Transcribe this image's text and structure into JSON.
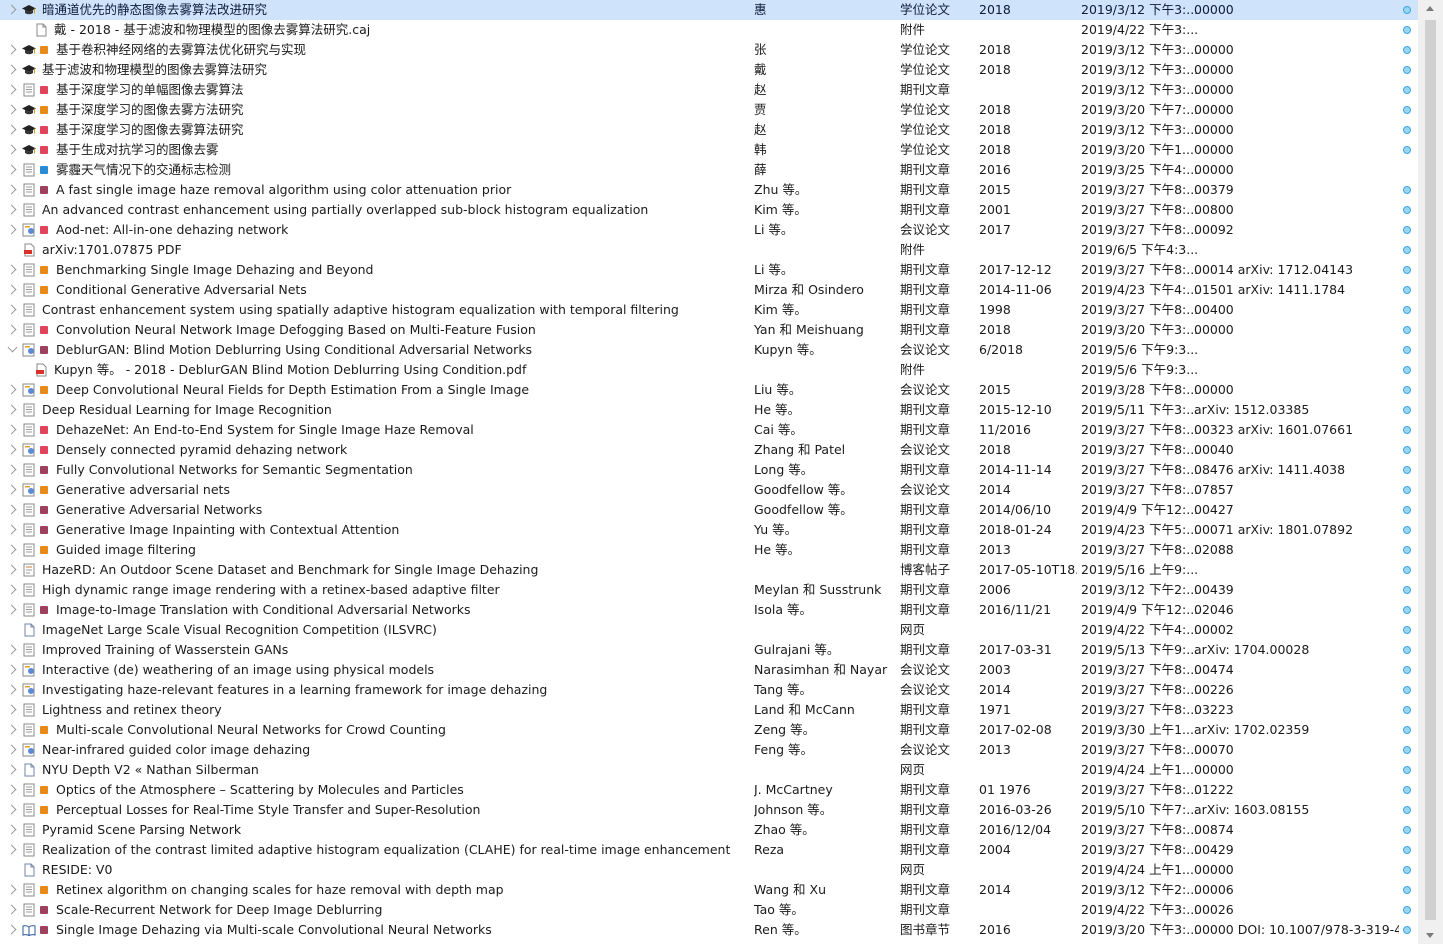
{
  "rows": [
    {
      "expander": "closed",
      "icon": "thesis",
      "dot": "",
      "title": "暗通道优先的静态图像去雾算法改进研究",
      "creator": "惠",
      "type": "学位论文",
      "date": "2018",
      "modified": "2019/3/12 下午3:...",
      "extra": "00000",
      "attachment": true,
      "selected": true
    },
    {
      "expander": "none",
      "icon": "file",
      "dot": "",
      "title": "戴 - 2018 - 基于滤波和物理模型的图像去雾算法研究.caj",
      "creator": "",
      "type": "附件",
      "date": "",
      "modified": "2019/4/22 下午3:...",
      "extra": "",
      "attachment": true,
      "child": true
    },
    {
      "expander": "closed",
      "icon": "thesis",
      "dot": "#e88a1a",
      "title": "基于卷积神经网络的去雾算法优化研究与实现",
      "creator": "张",
      "type": "学位论文",
      "date": "2018",
      "modified": "2019/3/12 下午3:...",
      "extra": "00000",
      "attachment": true
    },
    {
      "expander": "closed",
      "icon": "thesis",
      "dot": "",
      "title": "基于滤波和物理模型的图像去雾算法研究",
      "creator": "戴",
      "type": "学位论文",
      "date": "2018",
      "modified": "2019/3/12 下午3:...",
      "extra": "00000",
      "attachment": true
    },
    {
      "expander": "closed",
      "icon": "article",
      "dot": "#e2425b",
      "title": "基于深度学习的单幅图像去雾算法",
      "creator": "赵",
      "type": "期刊文章",
      "date": "",
      "modified": "2019/3/12 下午3:...",
      "extra": "00000",
      "attachment": true
    },
    {
      "expander": "closed",
      "icon": "thesis",
      "dot": "#e88a1a",
      "title": "基于深度学习的图像去雾方法研究",
      "creator": "贾",
      "type": "学位论文",
      "date": "2018",
      "modified": "2019/3/20 下午7:...",
      "extra": "00000",
      "attachment": true
    },
    {
      "expander": "closed",
      "icon": "thesis",
      "dot": "#e2425b",
      "title": "基于深度学习的图像去雾算法研究",
      "creator": "赵",
      "type": "学位论文",
      "date": "2018",
      "modified": "2019/3/12 下午3:...",
      "extra": "00000",
      "attachment": true
    },
    {
      "expander": "closed",
      "icon": "thesis",
      "dot": "#e2425b",
      "title": "基于生成对抗学习的图像去雾",
      "creator": "韩",
      "type": "学位论文",
      "date": "2018",
      "modified": "2019/3/20 下午1...",
      "extra": "00000",
      "attachment": true
    },
    {
      "expander": "closed",
      "icon": "article",
      "dot": "#2a8ad4",
      "title": "雾霾天气情况下的交通标志检测",
      "creator": "薛",
      "type": "期刊文章",
      "date": "2016",
      "modified": "2019/3/25 下午4:...",
      "extra": "00000",
      "attachment": false
    },
    {
      "expander": "closed",
      "icon": "article",
      "dot": "#a0405f",
      "title": "A fast single image haze removal algorithm using color attenuation prior",
      "creator": "Zhu 等。",
      "type": "期刊文章",
      "date": "2015",
      "modified": "2019/3/27 下午8:...",
      "extra": "00379",
      "attachment": true
    },
    {
      "expander": "closed",
      "icon": "article",
      "dot": "",
      "title": "An advanced contrast enhancement using partially overlapped sub-block histogram equalization",
      "creator": "Kim 等。",
      "type": "期刊文章",
      "date": "2001",
      "modified": "2019/3/27 下午8:...",
      "extra": "00800",
      "attachment": true
    },
    {
      "expander": "closed",
      "icon": "conference",
      "dot": "#e2425b",
      "title": "Aod-net: All-in-one dehazing network",
      "creator": "Li 等。",
      "type": "会议论文",
      "date": "2017",
      "modified": "2019/3/27 下午8:...",
      "extra": "00092",
      "attachment": true
    },
    {
      "expander": "none",
      "icon": "pdf",
      "dot": "",
      "title": "arXiv:1701.07875 PDF",
      "creator": "",
      "type": "附件",
      "date": "",
      "modified": "2019/6/5 下午4:3...",
      "extra": "",
      "attachment": true
    },
    {
      "expander": "closed",
      "icon": "article",
      "dot": "#e88a1a",
      "title": "Benchmarking Single Image Dehazing and Beyond",
      "creator": "Li 等。",
      "type": "期刊文章",
      "date": "2017-12-12",
      "modified": "2019/3/27 下午8:...",
      "extra": "00014 arXiv: 1712.04143",
      "attachment": true
    },
    {
      "expander": "closed",
      "icon": "article",
      "dot": "#e88a1a",
      "title": "Conditional Generative Adversarial Nets",
      "creator": "Mirza 和 Osindero",
      "type": "期刊文章",
      "date": "2014-11-06",
      "modified": "2019/4/23 下午4:...",
      "extra": "01501 arXiv: 1411.1784",
      "attachment": true
    },
    {
      "expander": "closed",
      "icon": "article",
      "dot": "",
      "title": "Contrast enhancement system using spatially adaptive histogram equalization with temporal filtering",
      "creator": "Kim 等。",
      "type": "期刊文章",
      "date": "1998",
      "modified": "2019/3/27 下午8:...",
      "extra": "00400",
      "attachment": true
    },
    {
      "expander": "closed",
      "icon": "article",
      "dot": "#e2425b",
      "title": "Convolution Neural Network Image Defogging Based on Multi-Feature Fusion",
      "creator": "Yan 和 Meishuang",
      "type": "期刊文章",
      "date": "2018",
      "modified": "2019/3/20 下午3:...",
      "extra": "00000",
      "attachment": true
    },
    {
      "expander": "open",
      "icon": "conference",
      "dot": "#a0405f",
      "title": "DeblurGAN: Blind Motion Deblurring Using Conditional Adversarial Networks",
      "creator": "Kupyn 等。",
      "type": "会议论文",
      "date": "6/2018",
      "modified": "2019/5/6 下午9:3...",
      "extra": "",
      "attachment": true
    },
    {
      "expander": "none",
      "icon": "pdf",
      "dot": "",
      "title": "Kupyn 等。 - 2018 - DeblurGAN Blind Motion Deblurring Using Condition.pdf",
      "creator": "",
      "type": "附件",
      "date": "",
      "modified": "2019/5/6 下午9:3...",
      "extra": "",
      "attachment": true,
      "child": true
    },
    {
      "expander": "closed",
      "icon": "conference",
      "dot": "#e88a1a",
      "title": "Deep Convolutional Neural Fields for Depth Estimation From a Single Image",
      "creator": "Liu 等。",
      "type": "会议论文",
      "date": "2015",
      "modified": "2019/3/28 下午8:...",
      "extra": "00000",
      "attachment": true
    },
    {
      "expander": "closed",
      "icon": "article",
      "dot": "",
      "title": "Deep Residual Learning for Image Recognition",
      "creator": "He 等。",
      "type": "期刊文章",
      "date": "2015-12-10",
      "modified": "2019/5/11 下午3:...",
      "extra": "arXiv: 1512.03385",
      "attachment": true
    },
    {
      "expander": "closed",
      "icon": "article",
      "dot": "#e2425b",
      "title": "DehazeNet: An End-to-End System for Single Image Haze Removal",
      "creator": "Cai 等。",
      "type": "期刊文章",
      "date": "11/2016",
      "modified": "2019/3/27 下午8:...",
      "extra": "00323 arXiv: 1601.07661",
      "attachment": true
    },
    {
      "expander": "closed",
      "icon": "conference",
      "dot": "#e2425b",
      "title": "Densely connected pyramid dehazing network",
      "creator": "Zhang 和 Patel",
      "type": "会议论文",
      "date": "2018",
      "modified": "2019/3/27 下午8:...",
      "extra": "00040",
      "attachment": true
    },
    {
      "expander": "closed",
      "icon": "article",
      "dot": "#a0405f",
      "title": "Fully Convolutional Networks for Semantic Segmentation",
      "creator": "Long 等。",
      "type": "期刊文章",
      "date": "2014-11-14",
      "modified": "2019/3/27 下午8:...",
      "extra": "08476 arXiv: 1411.4038",
      "attachment": true
    },
    {
      "expander": "closed",
      "icon": "conference",
      "dot": "#e88a1a",
      "title": "Generative adversarial nets",
      "creator": "Goodfellow 等。",
      "type": "会议论文",
      "date": "2014",
      "modified": "2019/3/27 下午8:...",
      "extra": "07857",
      "attachment": true
    },
    {
      "expander": "closed",
      "icon": "article",
      "dot": "#a0405f",
      "title": "Generative Adversarial Networks",
      "creator": "Goodfellow 等。",
      "type": "期刊文章",
      "date": "2014/06/10",
      "modified": "2019/4/9 下午12:...",
      "extra": "00427",
      "attachment": true
    },
    {
      "expander": "closed",
      "icon": "article",
      "dot": "#a0405f",
      "title": "Generative Image Inpainting with Contextual Attention",
      "creator": "Yu 等。",
      "type": "期刊文章",
      "date": "2018-01-24",
      "modified": "2019/4/23 下午5:...",
      "extra": "00071 arXiv: 1801.07892",
      "attachment": true
    },
    {
      "expander": "closed",
      "icon": "article",
      "dot": "#e88a1a",
      "title": "Guided image filtering",
      "creator": "He 等。",
      "type": "期刊文章",
      "date": "2013",
      "modified": "2019/3/27 下午8:...",
      "extra": "02088",
      "attachment": true
    },
    {
      "expander": "closed",
      "icon": "blog",
      "dot": "",
      "title": "HazeRD: An Outdoor Scene Dataset and Benchmark for Single Image Dehazing",
      "creator": "",
      "type": "博客帖子",
      "date": "2017-05-10T18...",
      "modified": "2019/5/16 上午9:...",
      "extra": "",
      "attachment": true
    },
    {
      "expander": "closed",
      "icon": "article",
      "dot": "",
      "title": "High dynamic range image rendering with a retinex-based adaptive filter",
      "creator": "Meylan 和 Susstrunk",
      "type": "期刊文章",
      "date": "2006",
      "modified": "2019/3/12 下午2:...",
      "extra": "00439",
      "attachment": true
    },
    {
      "expander": "closed",
      "icon": "article",
      "dot": "#a0405f",
      "title": "Image-to-Image Translation with Conditional Adversarial Networks",
      "creator": "Isola 等。",
      "type": "期刊文章",
      "date": "2016/11/21",
      "modified": "2019/4/9 下午12:...",
      "extra": "02046",
      "attachment": true
    },
    {
      "expander": "none",
      "icon": "webpage",
      "dot": "",
      "title": "ImageNet Large Scale Visual Recognition Competition (ILSVRC)",
      "creator": "",
      "type": "网页",
      "date": "",
      "modified": "2019/4/22 下午4:...",
      "extra": "00002",
      "attachment": true
    },
    {
      "expander": "closed",
      "icon": "article",
      "dot": "",
      "title": "Improved Training of Wasserstein GANs",
      "creator": "Gulrajani 等。",
      "type": "期刊文章",
      "date": "2017-03-31",
      "modified": "2019/5/13 下午9:...",
      "extra": "arXiv: 1704.00028",
      "attachment": true
    },
    {
      "expander": "closed",
      "icon": "conference",
      "dot": "",
      "title": "Interactive (de) weathering of an image using physical models",
      "creator": "Narasimhan 和 Nayar",
      "type": "会议论文",
      "date": "2003",
      "modified": "2019/3/27 下午8:...",
      "extra": "00474",
      "attachment": true
    },
    {
      "expander": "closed",
      "icon": "conference",
      "dot": "",
      "title": "Investigating haze-relevant features in a learning framework for image dehazing",
      "creator": "Tang 等。",
      "type": "会议论文",
      "date": "2014",
      "modified": "2019/3/27 下午8:...",
      "extra": "00226",
      "attachment": true
    },
    {
      "expander": "closed",
      "icon": "article",
      "dot": "",
      "title": "Lightness and retinex theory",
      "creator": "Land 和 McCann",
      "type": "期刊文章",
      "date": "1971",
      "modified": "2019/3/27 下午8:...",
      "extra": "03223",
      "attachment": true
    },
    {
      "expander": "closed",
      "icon": "article",
      "dot": "#e88a1a",
      "title": "Multi-scale Convolutional Neural Networks for Crowd Counting",
      "creator": "Zeng 等。",
      "type": "期刊文章",
      "date": "2017-02-08",
      "modified": "2019/3/30 上午1...",
      "extra": "arXiv: 1702.02359",
      "attachment": true
    },
    {
      "expander": "closed",
      "icon": "conference",
      "dot": "",
      "title": "Near-infrared guided color image dehazing",
      "creator": "Feng 等。",
      "type": "会议论文",
      "date": "2013",
      "modified": "2019/3/27 下午8:...",
      "extra": "00070",
      "attachment": true
    },
    {
      "expander": "closed",
      "icon": "webpage",
      "dot": "",
      "title": "NYU Depth V2 « Nathan Silberman",
      "creator": "",
      "type": "网页",
      "date": "",
      "modified": "2019/4/24 上午1...",
      "extra": "00000",
      "attachment": true
    },
    {
      "expander": "closed",
      "icon": "article",
      "dot": "#e88a1a",
      "title": "Optics of the Atmosphere – Scattering by Molecules and Particles",
      "creator": "J. McCartney",
      "type": "期刊文章",
      "date": "01 1976",
      "modified": "2019/3/27 下午8:...",
      "extra": "01222",
      "attachment": true
    },
    {
      "expander": "closed",
      "icon": "article",
      "dot": "#e88a1a",
      "title": "Perceptual Losses for Real-Time Style Transfer and Super-Resolution",
      "creator": "Johnson 等。",
      "type": "期刊文章",
      "date": "2016-03-26",
      "modified": "2019/5/10 下午7:...",
      "extra": "arXiv: 1603.08155",
      "attachment": true
    },
    {
      "expander": "closed",
      "icon": "article",
      "dot": "",
      "title": "Pyramid Scene Parsing Network",
      "creator": "Zhao 等。",
      "type": "期刊文章",
      "date": "2016/12/04",
      "modified": "2019/3/27 下午8:...",
      "extra": "00874",
      "attachment": true
    },
    {
      "expander": "closed",
      "icon": "article",
      "dot": "",
      "title": "Realization of the contrast limited adaptive histogram equalization (CLAHE) for real-time image enhancement",
      "creator": "Reza",
      "type": "期刊文章",
      "date": "2004",
      "modified": "2019/3/27 下午8:...",
      "extra": "00429",
      "attachment": true
    },
    {
      "expander": "none",
      "icon": "webpage",
      "dot": "",
      "title": "RESIDE: V0",
      "creator": "",
      "type": "网页",
      "date": "",
      "modified": "2019/4/24 上午1...",
      "extra": "00000",
      "attachment": true
    },
    {
      "expander": "closed",
      "icon": "article",
      "dot": "#e88a1a",
      "title": "Retinex algorithm on changing scales for haze removal with depth map",
      "creator": "Wang 和 Xu",
      "type": "期刊文章",
      "date": "2014",
      "modified": "2019/3/12 下午2:...",
      "extra": "00006",
      "attachment": true
    },
    {
      "expander": "closed",
      "icon": "article",
      "dot": "#a0405f",
      "title": "Scale-Recurrent Network for Deep Image Deblurring",
      "creator": "Tao 等。",
      "type": "期刊文章",
      "date": "",
      "modified": "2019/4/22 下午3:...",
      "extra": "00026",
      "attachment": true
    },
    {
      "expander": "closed",
      "icon": "book",
      "dot": "#a0405f",
      "title": "Single Image Dehazing via Multi-scale Convolutional Neural Networks",
      "creator": "Ren 等。",
      "type": "图书章节",
      "date": "2016",
      "modified": "2019/3/20 下午3:...",
      "extra": "00000 DOI: 10.1007/978-3-319-4...",
      "attachment": true
    }
  ],
  "icons": {
    "thesis": "graduation-cap-icon",
    "article": "journal-article-icon",
    "conference": "conference-paper-icon",
    "file": "file-attachment-icon",
    "pdf": "pdf-attachment-icon",
    "blog": "blog-post-icon",
    "webpage": "webpage-icon",
    "book": "book-section-icon"
  }
}
